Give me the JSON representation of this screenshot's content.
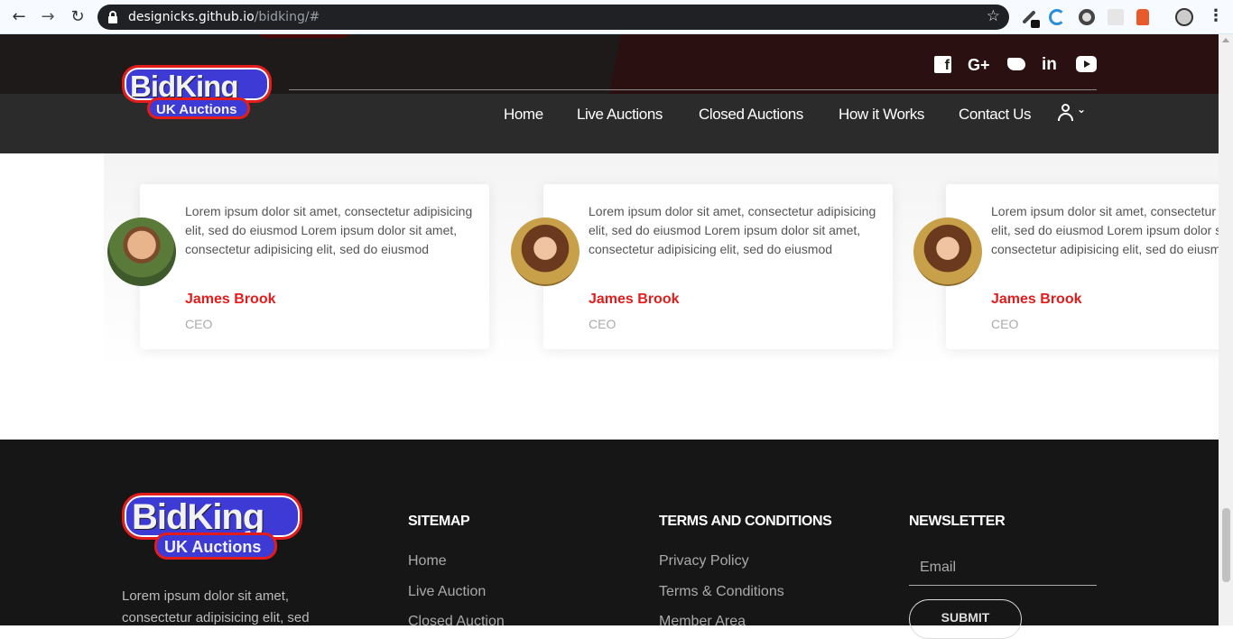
{
  "browser": {
    "url_domain": "designicks.github.io",
    "url_path": "/bidking/#",
    "back_icon": "←",
    "forward_icon": "→",
    "reload_icon": "↻",
    "star_icon": "☆",
    "menu_icon": "⋮"
  },
  "brand": {
    "logo_main": "BidKing",
    "logo_sub": "UK Auctions",
    "accent": "#e41c1c",
    "logo_blue": "#3d3ad6"
  },
  "header": {
    "social": [
      "facebook-icon",
      "google-plus-icon",
      "twitter-icon",
      "linkedin-icon",
      "youtube-icon"
    ],
    "social_fb": "f",
    "social_gp": "G+",
    "social_in": "in",
    "nav": [
      "Home",
      "Live Auctions",
      "Closed Auctions",
      "How it Works",
      "Contact Us"
    ],
    "user_chevron": "⌄"
  },
  "testimonials": [
    {
      "quote": "Lorem ipsum dolor sit amet, consectetur adipisicing elit, sed do eiusmod Lorem ipsum dolor sit amet, consectetur adipisicing elit, sed do eiusmod",
      "name": "James Brook",
      "role": "CEO"
    },
    {
      "quote": "Lorem ipsum dolor sit amet, consectetur adipisicing elit, sed do eiusmod Lorem ipsum dolor sit amet, consectetur adipisicing elit, sed do eiusmod",
      "name": "James Brook",
      "role": "CEO"
    },
    {
      "quote": "Lorem ipsum dolor sit amet, consectetur adipisicing elit, sed do eiusmod Lorem ipsum dolor sit amet, consectetur adipisicing elit, sed do eiusmod",
      "name": "James Brook",
      "role": "CEO"
    }
  ],
  "footer": {
    "about": "Lorem ipsum dolor sit amet, consectetur adipisicing elit, sed",
    "sitemap_title": "SITEMAP",
    "sitemap_links": [
      "Home",
      "Live Auction",
      "Closed Auction"
    ],
    "terms_title": "TERMS AND CONDITIONS",
    "terms_links": [
      "Privacy Policy",
      "Terms & Conditions",
      "Member Area"
    ],
    "newsletter_title": "NEWSLETTER",
    "email_placeholder": "Email",
    "submit_label": "SUBMIT"
  }
}
